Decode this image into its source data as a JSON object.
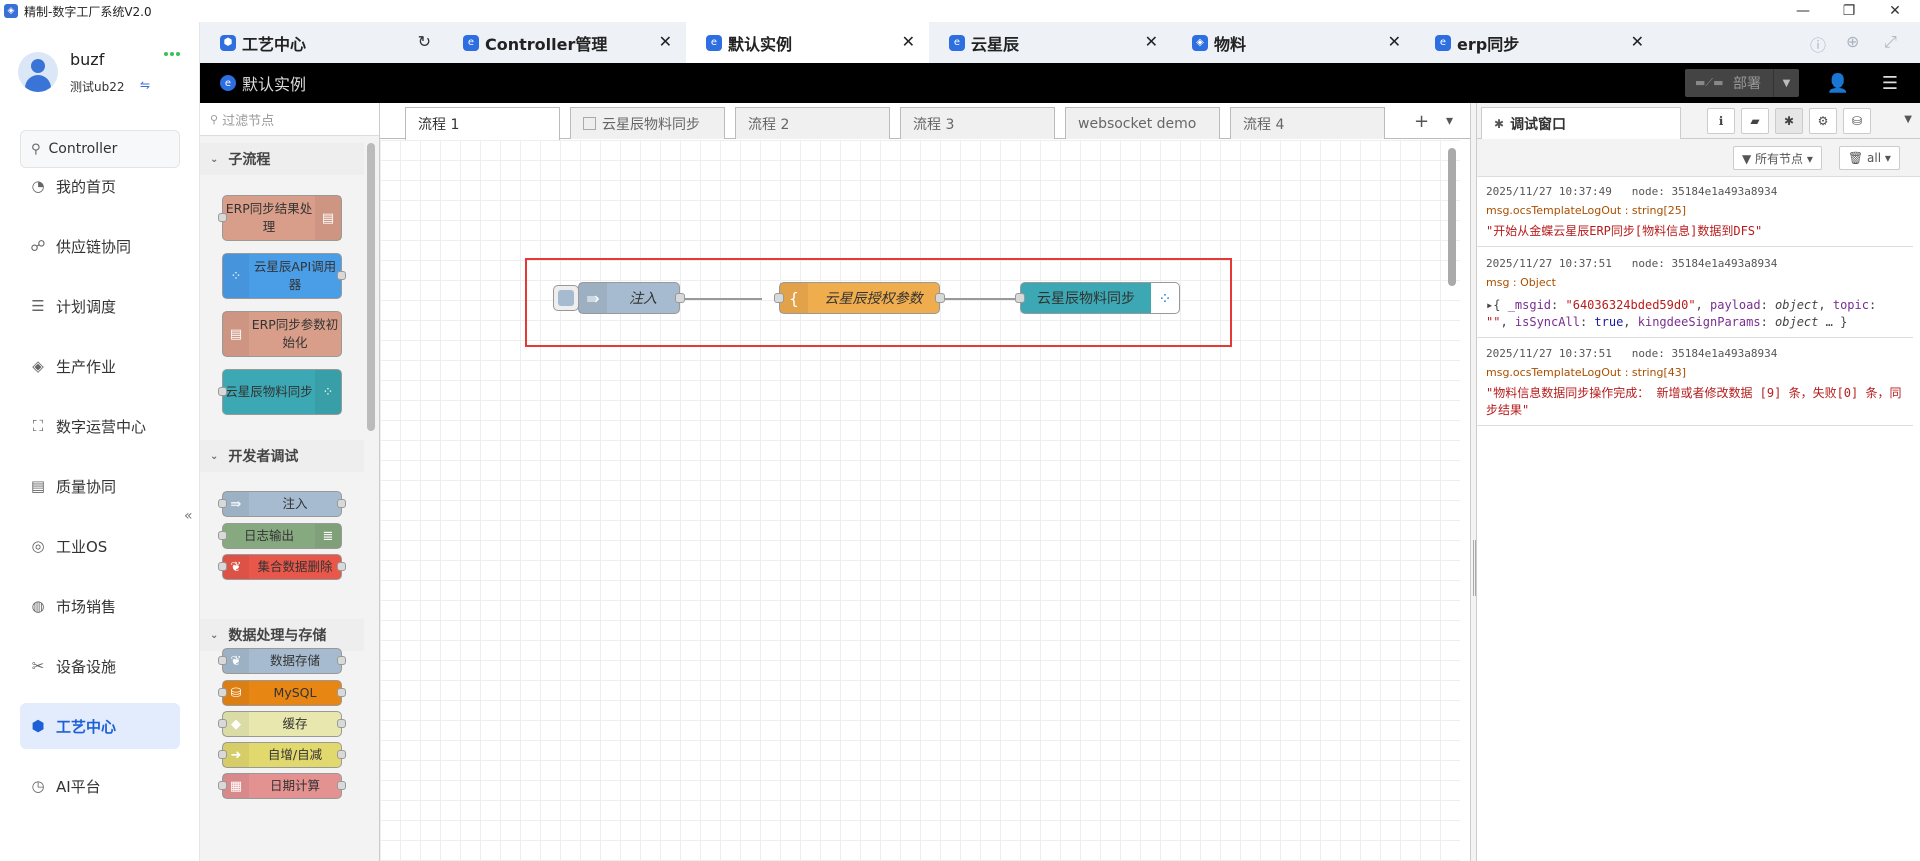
{
  "window": {
    "title": "精制-数字工厂系统V2.0",
    "icon": "app-logo-icon",
    "controls": [
      "minimize-icon",
      "maximize-icon",
      "close-icon"
    ],
    "minimize": "—",
    "maximize": "❐",
    "close": "✕"
  },
  "user": {
    "name": "buzf",
    "org": "测试ub22",
    "switch_icon": "⇋"
  },
  "sidebar": {
    "search_value": "Controller",
    "search_icon": "⚲",
    "items": [
      {
        "label": "我的首页",
        "icon": "home-icon",
        "glyph": "◔"
      },
      {
        "label": "供应链协同",
        "icon": "supply-chain-icon",
        "glyph": "☍"
      },
      {
        "label": "计划调度",
        "icon": "schedule-icon",
        "glyph": "☰"
      },
      {
        "label": "生产作业",
        "icon": "layers-icon",
        "glyph": "◈"
      },
      {
        "label": "数字运营中心",
        "icon": "chart-icon",
        "glyph": "⛶"
      },
      {
        "label": "质量协同",
        "icon": "quality-icon",
        "glyph": "▤"
      },
      {
        "label": "工业OS",
        "icon": "os-icon",
        "glyph": "◎"
      },
      {
        "label": "市场销售",
        "icon": "sales-icon",
        "glyph": "◍"
      },
      {
        "label": "设备设施",
        "icon": "tools-icon",
        "glyph": "✂"
      },
      {
        "label": "工艺中心",
        "icon": "cube-icon",
        "glyph": "⬢",
        "active": true
      },
      {
        "label": "AI平台",
        "icon": "ai-icon",
        "glyph": "◷"
      }
    ],
    "collapse_glyph": "«"
  },
  "tabs": [
    {
      "label": "工艺中心",
      "icon": "cube-icon",
      "glyph": "⬢",
      "action": "refresh"
    },
    {
      "label": "Controller管理",
      "icon": "app-logo-icon",
      "glyph": "e",
      "action": "close"
    },
    {
      "label": "默认实例",
      "icon": "app-logo-icon",
      "glyph": "e",
      "action": "close",
      "active": true
    },
    {
      "label": "云星辰",
      "icon": "app-logo-icon",
      "glyph": "e",
      "action": "close"
    },
    {
      "label": "物料",
      "icon": "app-logo-icon",
      "glyph": "◈",
      "action": "close"
    },
    {
      "label": "erp同步",
      "icon": "app-logo-icon",
      "glyph": "e",
      "action": "close"
    }
  ],
  "tab_glyphs": {
    "close": "✕",
    "refresh": "↻"
  },
  "tab_tools": [
    "ⓘ",
    "⊕",
    "⤢"
  ],
  "header": {
    "title": "默认实例",
    "deploy_label": "部署",
    "deploy_glyph": "▬⟋▬",
    "deploy_dd": "▼",
    "user_glyph": "👤",
    "menu_glyph": "☰"
  },
  "palette": {
    "filter_placeholder": "过滤节点",
    "filter_icon": "⚲",
    "cat_chev": "⌄",
    "categories": [
      {
        "label": "子流程"
      },
      {
        "label": "开发者调试"
      },
      {
        "label": "数据处理与存储"
      }
    ],
    "nodes": [
      {
        "label": "ERP同步结果处理",
        "color": "#d99e8a",
        "glyph": "▤",
        "side": "right"
      },
      {
        "label": "云星辰API调用器",
        "color": "#4a9ee8",
        "glyph": "⁘",
        "side": "left"
      },
      {
        "label": "ERP同步参数初始化",
        "color": "#d99e8a",
        "glyph": "▤",
        "side": "left"
      },
      {
        "label": "云星辰物料同步",
        "color": "#3ba8b3",
        "glyph": "⁘",
        "side": "right"
      },
      {
        "label": "注入",
        "color": "#a6bbcf",
        "glyph": "⇛",
        "side": "left"
      },
      {
        "label": "日志输出",
        "color": "#87a980",
        "glyph": "≣",
        "side": "right"
      },
      {
        "label": "集合数据删除",
        "color": "#e9574a",
        "glyph": "❦",
        "side": "left"
      },
      {
        "label": "数据存储",
        "color": "#a6bbcf",
        "glyph": "❦",
        "side": "left"
      },
      {
        "label": "MySQL",
        "color": "#e88614",
        "glyph": "⛁",
        "side": "left"
      },
      {
        "label": "缓存",
        "color": "#e7e7ae",
        "glyph": "◆",
        "side": "left"
      },
      {
        "label": "自增/自减",
        "color": "#e2d96e",
        "glyph": "➜",
        "side": "left"
      },
      {
        "label": "日期计算",
        "color": "#e49191",
        "glyph": "▦",
        "side": "left"
      }
    ]
  },
  "workspace": {
    "tabs": [
      {
        "label": "流程 1",
        "active": true
      },
      {
        "label": "云星辰物料同步",
        "subflow": true
      },
      {
        "label": "流程 2"
      },
      {
        "label": "流程 3"
      },
      {
        "label": "websocket demo"
      },
      {
        "label": "流程 4"
      }
    ],
    "add_glyph": "+",
    "menu_glyph": "▾",
    "flow_nodes": [
      {
        "label": "注入",
        "color": "#a6bbcf",
        "glyph": "⇛"
      },
      {
        "label": "云星辰授权参数",
        "color": "#f0ad4e",
        "glyph": "{"
      },
      {
        "label": "云星辰物料同步",
        "color": "#3ba8b3",
        "glyph": "⁘"
      }
    ]
  },
  "debug": {
    "tab_label": "调试窗口",
    "tab_glyph": "✱",
    "buttons": [
      {
        "icon": "info-icon",
        "glyph": "ℹ"
      },
      {
        "icon": "book-icon",
        "glyph": "▰"
      },
      {
        "icon": "bug-icon",
        "glyph": "✱",
        "selected": true
      },
      {
        "icon": "gear-icon",
        "glyph": "⚙"
      },
      {
        "icon": "database-icon",
        "glyph": "⛁"
      }
    ],
    "dd_glyph": "▼",
    "filter_nodes": "▼ 所有节点 ▾",
    "filter_clear": "🗑 all ▾",
    "messages": [
      {
        "time": "2025/11/27 10:37:49",
        "node": "node: 35184e1a493a8934",
        "topic": "msg.ocsTemplateLogOut : string[25]",
        "value": "\"开始从金蝶云星辰ERP同步[物料信息]数据到DFS\""
      },
      {
        "time": "2025/11/27 10:37:51",
        "node": "node: 35184e1a493a8934",
        "topic": "msg : Object",
        "obj": {
          "open": "▸{ ",
          "k1": "_msgid",
          "v1": "\"64036324bded59d0\"",
          "k2": "payload",
          "v2": "object",
          "k3": "topic",
          "v3": "\"\"",
          "k4": "isSyncAll",
          "v4": "true",
          "k5": "kingdeeSignParams",
          "v5": "object",
          "close": " … }"
        }
      },
      {
        "time": "2025/11/27 10:37:51",
        "node": "node: 35184e1a493a8934",
        "topic": "msg.ocsTemplateLogOut : string[43]",
        "value": "\"物料信息数据同步操作完成： 新增或者修改数据 [9] 条，失败[0] 条，同步结果\""
      }
    ]
  }
}
